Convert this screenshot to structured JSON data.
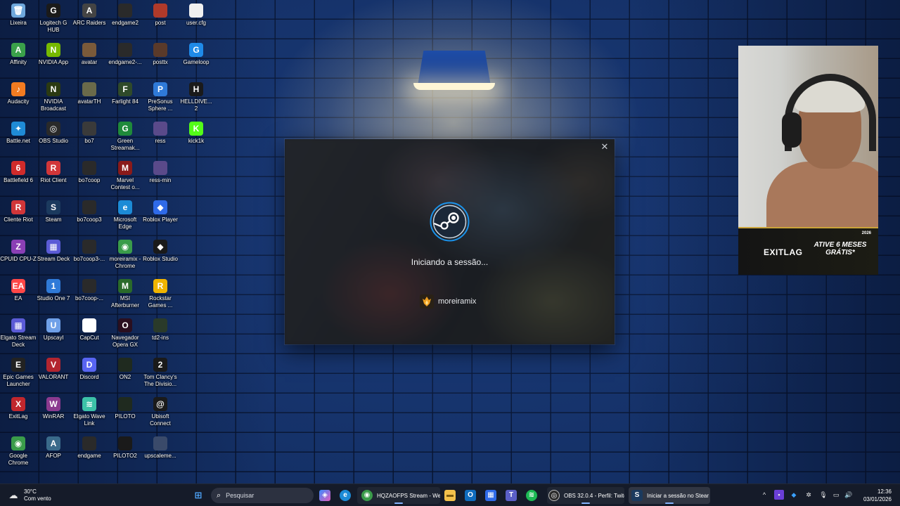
{
  "desktop": {
    "icons": [
      {
        "label": "Lixeira",
        "icon": "recycle-bin-icon",
        "color": "#6fa8dc",
        "glyph": "🗑"
      },
      {
        "label": "Affinity",
        "icon": "affinity-icon",
        "color": "#3aa14a",
        "glyph": "A"
      },
      {
        "label": "Audacity",
        "icon": "audacity-icon",
        "color": "#f27b21",
        "glyph": "♪"
      },
      {
        "label": "Battle.net",
        "icon": "battlenet-icon",
        "color": "#1f8bd6",
        "glyph": "✦"
      },
      {
        "label": "Battlefield 6",
        "icon": "battlefield-icon",
        "color": "#d02b2b",
        "glyph": "6"
      },
      {
        "label": "Cliente Riot",
        "icon": "riot-client-icon",
        "color": "#d13639",
        "glyph": "R"
      },
      {
        "label": "CPUID CPU-Z",
        "icon": "cpuz-icon",
        "color": "#8a3fb5",
        "glyph": "Z"
      },
      {
        "label": "EA",
        "icon": "ea-icon",
        "color": "#ff4747",
        "glyph": "EA"
      },
      {
        "label": "Elgato Stream Deck",
        "icon": "stream-deck-icon",
        "color": "#5b5bd6",
        "glyph": "▦"
      },
      {
        "label": "Epic Games Launcher",
        "icon": "epic-games-icon",
        "color": "#222222",
        "glyph": "E"
      },
      {
        "label": "ExitLag",
        "icon": "exitlag-icon",
        "color": "#c0272d",
        "glyph": "X"
      },
      {
        "label": "Google Chrome",
        "icon": "chrome-icon",
        "color": "#3a9c4a",
        "glyph": "◉"
      },
      {
        "label": "Logitech G HUB",
        "icon": "logitech-ghub-icon",
        "color": "#1a1a1a",
        "glyph": "G"
      },
      {
        "label": "NVIDIA App",
        "icon": "nvidia-app-icon",
        "color": "#76b900",
        "glyph": "N"
      },
      {
        "label": "NVIDIA Broadcast",
        "icon": "nvidia-broadcast-icon",
        "color": "#2b3a12",
        "glyph": "N"
      },
      {
        "label": "OBS Studio",
        "icon": "obs-icon",
        "color": "#2a2a2a",
        "glyph": "◎"
      },
      {
        "label": "Riot Client",
        "icon": "riot-client-icon-2",
        "color": "#d13639",
        "glyph": "R"
      },
      {
        "label": "Steam",
        "icon": "steam-icon",
        "color": "#1b3a5e",
        "glyph": "S"
      },
      {
        "label": "Stream Deck",
        "icon": "stream-deck-icon-2",
        "color": "#5b5bd6",
        "glyph": "▦"
      },
      {
        "label": "Studio One 7",
        "icon": "studio-one-icon",
        "color": "#2f7ad8",
        "glyph": "1"
      },
      {
        "label": "Upscayl",
        "icon": "upscayl-icon",
        "color": "#6fa0e8",
        "glyph": "U"
      },
      {
        "label": "VALORANT",
        "icon": "valorant-icon",
        "color": "#b3252f",
        "glyph": "V"
      },
      {
        "label": "WinRAR",
        "icon": "winrar-icon",
        "color": "#8b3a8f",
        "glyph": "W"
      },
      {
        "label": "AFOP",
        "icon": "afop-icon",
        "color": "#3a6a8a",
        "glyph": "A"
      },
      {
        "label": "ARC Raiders",
        "icon": "arc-raiders-icon",
        "color": "#444444",
        "glyph": "A"
      },
      {
        "label": "avatar",
        "icon": "image-file-icon",
        "color": "#7a5a3a",
        "glyph": ""
      },
      {
        "label": "avatarTH",
        "icon": "image-file-icon-2",
        "color": "#6a6a4a",
        "glyph": ""
      },
      {
        "label": "bo7",
        "icon": "image-file-icon-3",
        "color": "#3a3a3a",
        "glyph": ""
      },
      {
        "label": "bo7coop",
        "icon": "video-file-icon",
        "color": "#2a2a2a",
        "glyph": ""
      },
      {
        "label": "bo7coop3",
        "icon": "video-file-icon-2",
        "color": "#2a2a2a",
        "glyph": ""
      },
      {
        "label": "bo7coop3-...",
        "icon": "video-file-icon-3",
        "color": "#2a2a2a",
        "glyph": ""
      },
      {
        "label": "bo7coop-...",
        "icon": "video-file-icon-4",
        "color": "#2a2a2a",
        "glyph": ""
      },
      {
        "label": "CapCut",
        "icon": "capcut-icon",
        "color": "#ffffff",
        "glyph": "✂"
      },
      {
        "label": "Discord",
        "icon": "discord-icon",
        "color": "#5865f2",
        "glyph": "D"
      },
      {
        "label": "Elgato Wave Link",
        "icon": "wave-link-icon",
        "color": "#3cc2a8",
        "glyph": "≋"
      },
      {
        "label": "endgame",
        "icon": "video-file-icon-5",
        "color": "#2a2a2a",
        "glyph": ""
      },
      {
        "label": "endgame2",
        "icon": "video-file-icon-6",
        "color": "#2a2a2a",
        "glyph": ""
      },
      {
        "label": "endgame2-...",
        "icon": "video-file-icon-7",
        "color": "#2a2a2a",
        "glyph": ""
      },
      {
        "label": "Farlight 84",
        "icon": "farlight-icon",
        "color": "#2f4a2a",
        "glyph": "F"
      },
      {
        "label": "Green Streamak...",
        "icon": "green-streamak-icon",
        "color": "#1f8a3a",
        "glyph": "G"
      },
      {
        "label": "Marvel Contest o...",
        "icon": "marvel-contest-icon",
        "color": "#8a1a1a",
        "glyph": "M"
      },
      {
        "label": "Microsoft Edge",
        "icon": "edge-icon",
        "color": "#1c8bd6",
        "glyph": "e"
      },
      {
        "label": "moreiramix - Chrome",
        "icon": "chrome-profile-icon",
        "color": "#3a9c4a",
        "glyph": "◉"
      },
      {
        "label": "MSI Afterburner",
        "icon": "msi-afterburner-icon",
        "color": "#2a6a2a",
        "glyph": "M"
      },
      {
        "label": "Navegador Opera GX",
        "icon": "opera-gx-icon",
        "color": "#2a0f1f",
        "glyph": "O"
      },
      {
        "label": "ON2",
        "icon": "video-file-icon-8",
        "color": "#1f2a1f",
        "glyph": ""
      },
      {
        "label": "PILOTO",
        "icon": "video-file-icon-9",
        "color": "#1f2a1f",
        "glyph": ""
      },
      {
        "label": "PILOTO2",
        "icon": "video-file-icon-10",
        "color": "#1a1a1a",
        "glyph": ""
      },
      {
        "label": "post",
        "icon": "image-file-icon-4",
        "color": "#b03a2a",
        "glyph": ""
      },
      {
        "label": "posttx",
        "icon": "image-file-icon-5",
        "color": "#5a3a2a",
        "glyph": ""
      },
      {
        "label": "PreSonus Sphere ...",
        "icon": "presonus-icon",
        "color": "#2f7ad8",
        "glyph": "P"
      },
      {
        "label": "ress",
        "icon": "image-file-icon-6",
        "color": "#5a4a8a",
        "glyph": ""
      },
      {
        "label": "ress-min",
        "icon": "image-file-icon-7",
        "color": "#5a4a8a",
        "glyph": ""
      },
      {
        "label": "Roblox Player",
        "icon": "roblox-player-icon",
        "color": "#2f6ae8",
        "glyph": "◆"
      },
      {
        "label": "Roblox Studio",
        "icon": "roblox-studio-icon",
        "color": "#1a1a1a",
        "glyph": "◆"
      },
      {
        "label": "Rockstar Games ...",
        "icon": "rockstar-icon",
        "color": "#f0b400",
        "glyph": "R"
      },
      {
        "label": "td2-ins",
        "icon": "image-file-icon-8",
        "color": "#2a3a2a",
        "glyph": ""
      },
      {
        "label": "Tom Clancy's The Divisio...",
        "icon": "division-icon",
        "color": "#1a1a1a",
        "glyph": "2"
      },
      {
        "label": "Ubisoft Connect",
        "icon": "ubisoft-icon",
        "color": "#1a1a1a",
        "glyph": "@"
      },
      {
        "label": "upscaleme...",
        "icon": "image-file-icon-9",
        "color": "#3a4a6a",
        "glyph": ""
      },
      {
        "label": "user.cfg",
        "icon": "text-file-icon",
        "color": "#f0f0f0",
        "glyph": ""
      },
      {
        "label": "Gameloop",
        "icon": "gameloop-icon",
        "color": "#1f8ae8",
        "glyph": "G"
      },
      {
        "label": "HELLDIVE... 2",
        "icon": "helldivers-icon",
        "color": "#1a1a1a",
        "glyph": "H"
      },
      {
        "label": "kick1k",
        "icon": "kick-icon",
        "color": "#53fc18",
        "glyph": "K"
      }
    ]
  },
  "webcam": {
    "ad_logo": "EXITLAG",
    "ad_text": "ATIVE 6 MESES GRÁTIS*",
    "ad_year": "2026"
  },
  "steam_dialog": {
    "status": "Iniciando a sessão...",
    "username": "moreiramix",
    "close_glyph": "✕",
    "accent_color": "#1a9fff"
  },
  "taskbar": {
    "weather": {
      "temp": "30°C",
      "condition": "Com vento"
    },
    "search_placeholder": "Pesquisar",
    "apps": [
      {
        "label": "HQZAOFPS Stream - We",
        "icon": "chrome-icon"
      },
      {
        "label": "OBS 32.0.4 - Perfil: Twitc",
        "icon": "obs-icon"
      },
      {
        "label": "Iniciar a sessão no Stear",
        "icon": "steam-icon"
      }
    ],
    "clock": {
      "time": "12:36",
      "date": "03/01/2026"
    }
  }
}
